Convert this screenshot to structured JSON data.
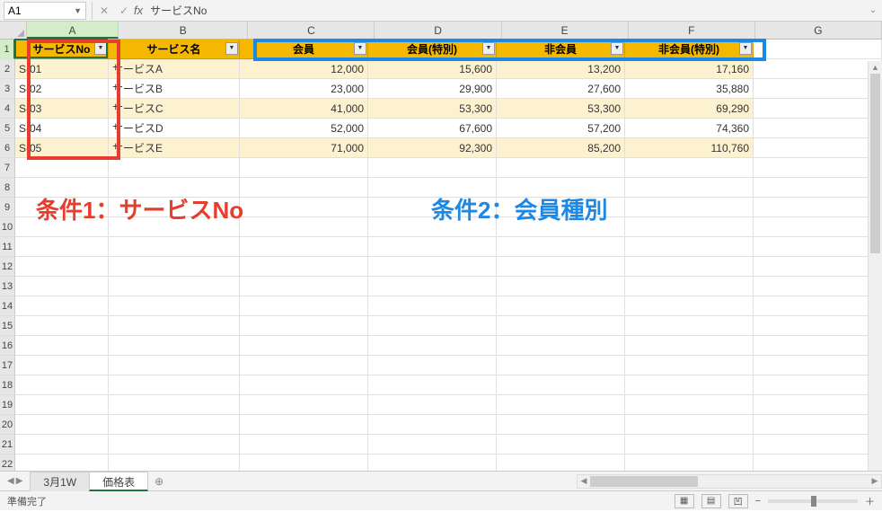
{
  "formula_bar": {
    "name_box": "A1",
    "content": "サービスNo"
  },
  "columns": [
    "A",
    "B",
    "C",
    "D",
    "E",
    "F",
    "G"
  ],
  "row_numbers": [
    1,
    2,
    3,
    4,
    5,
    6,
    7,
    8,
    9,
    10,
    11,
    12,
    13,
    14,
    15,
    16,
    17,
    18,
    19,
    20,
    21,
    22
  ],
  "table": {
    "headers": [
      "サービスNo",
      "サービス名",
      "会員",
      "会員(特別)",
      "非会員",
      "非会員(特別)"
    ],
    "rows": [
      {
        "no": "S-01",
        "name": "サービスA",
        "c": "12,000",
        "d": "15,600",
        "e": "13,200",
        "f": "17,160"
      },
      {
        "no": "S-02",
        "name": "サービスB",
        "c": "23,000",
        "d": "29,900",
        "e": "27,600",
        "f": "35,880"
      },
      {
        "no": "S-03",
        "name": "サービスC",
        "c": "41,000",
        "d": "53,300",
        "e": "53,300",
        "f": "69,290"
      },
      {
        "no": "S-04",
        "name": "サービスD",
        "c": "52,000",
        "d": "67,600",
        "e": "57,200",
        "f": "74,360"
      },
      {
        "no": "S-05",
        "name": "サービスE",
        "c": "71,000",
        "d": "92,300",
        "e": "85,200",
        "f": "110,760"
      }
    ]
  },
  "annotations": {
    "text1": "条件1：サービスNo",
    "text2": "条件2：会員種別"
  },
  "tabs": {
    "items": [
      "3月1W",
      "価格表"
    ],
    "active_index": 1
  },
  "status": {
    "label": "準備完了",
    "zoom_minus": "−",
    "zoom_plus": "＋"
  }
}
